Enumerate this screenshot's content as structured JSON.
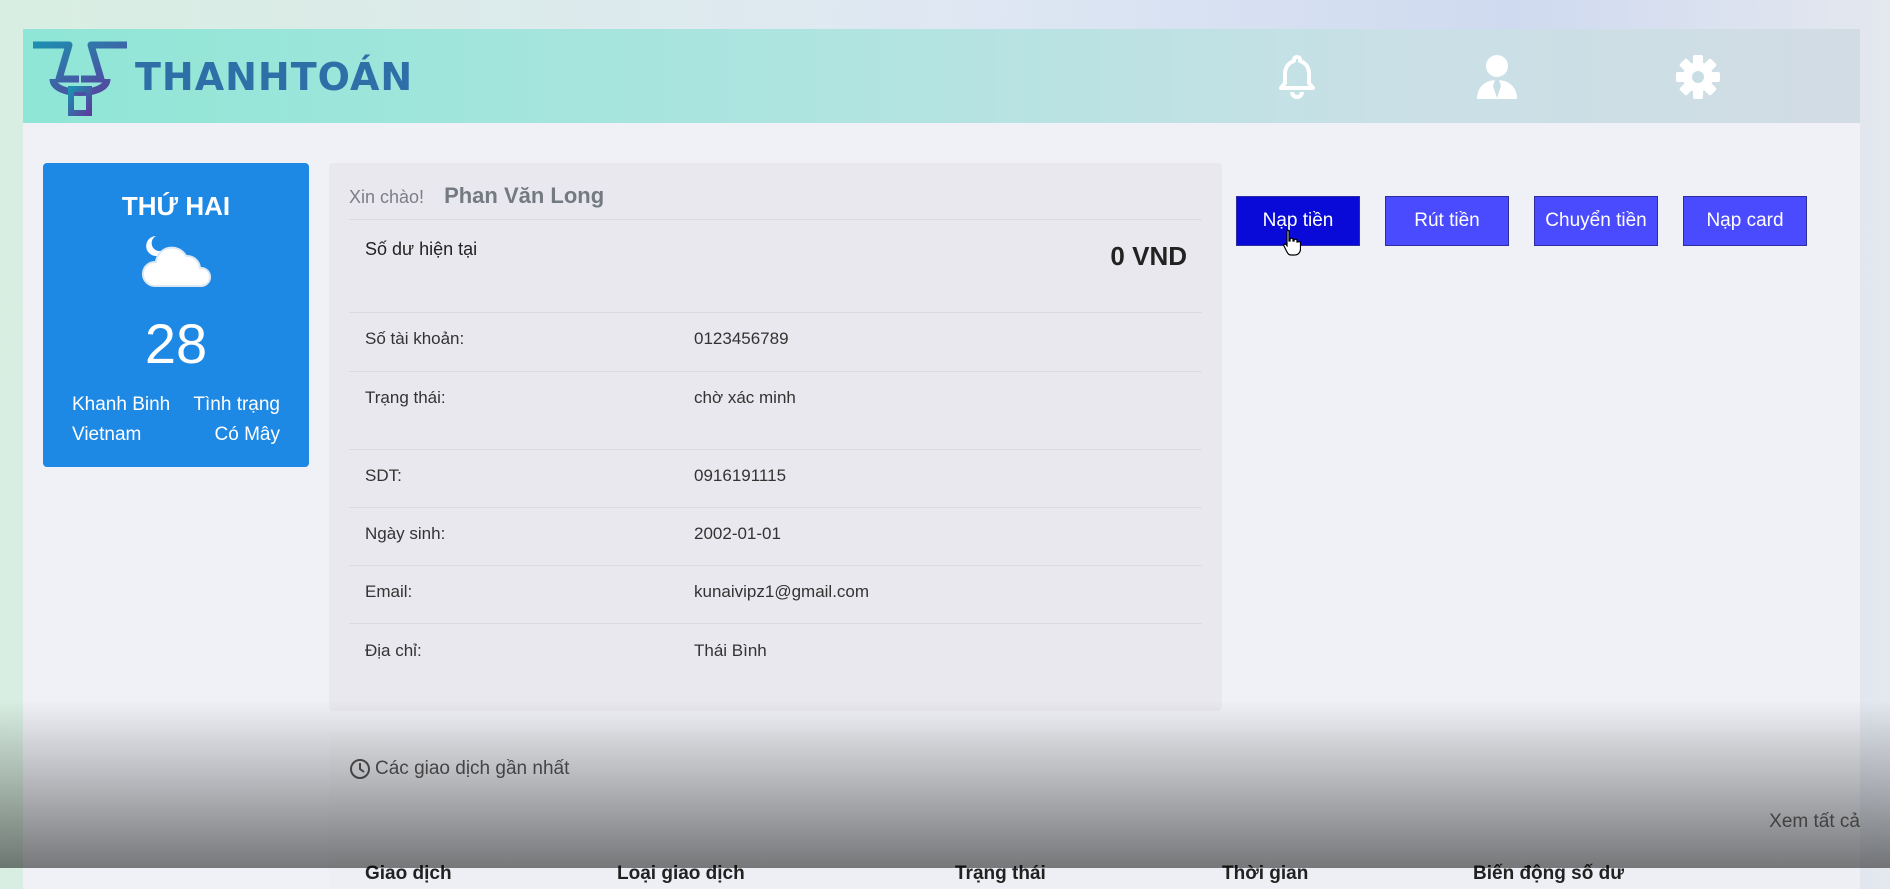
{
  "header": {
    "logo_text": "THANHTOÁN",
    "icons": [
      "bell-icon",
      "user-icon",
      "gear-icon"
    ]
  },
  "weather": {
    "day": "THỨ HAI",
    "temperature": "28",
    "city": "Khanh Binh",
    "country": "Vietnam",
    "status_label": "Tình trạng",
    "status_value": "Có Mây",
    "icon": "night-cloud-icon"
  },
  "profile": {
    "greeting": "Xin chào!",
    "name": "Phan Văn Long",
    "balance_label": "Số dư hiện tại",
    "balance_value": "0 VND",
    "fields": [
      {
        "label": "Số tài khoản:",
        "value": "0123456789"
      },
      {
        "label": "Trạng thái:",
        "value": "chờ xác minh"
      },
      {
        "label": "SDT:",
        "value": "0916191115"
      },
      {
        "label": "Ngày sinh:",
        "value": "2002-01-01"
      },
      {
        "label": "Email:",
        "value": "kunaivipz1@gmail.com"
      },
      {
        "label": "Địa chỉ:",
        "value": "Thái Bình"
      }
    ]
  },
  "actions": {
    "deposit": "Nạp tiền",
    "withdraw": "Rút tiền",
    "transfer": "Chuyển tiền",
    "card": "Nạp card"
  },
  "transactions": {
    "title": "Các giao dịch gần nhất",
    "see_all": "Xem tất cả",
    "columns": [
      "Giao dịch",
      "Loại giao dịch",
      "Trạng thái",
      "Thời gian",
      "Biến động số dư"
    ]
  },
  "colors": {
    "weather_bg": "#1e88e5",
    "primary_button": "#0a0ad8",
    "button": "#4a4aff"
  }
}
